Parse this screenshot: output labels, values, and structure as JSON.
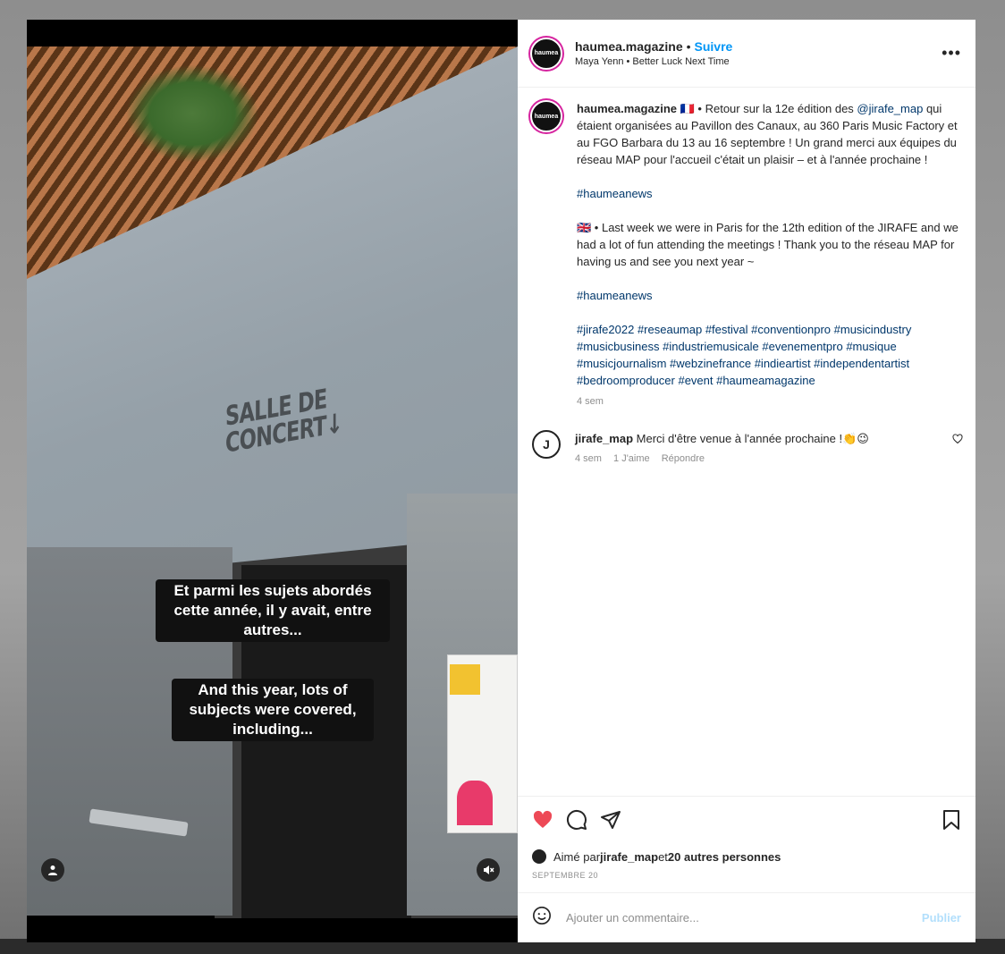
{
  "media": {
    "sign_text": "SALLE DE\nCONCERT↓",
    "caption_fr": "Et parmi les sujets abordés\ncette année, il y avait, entre\nautres...",
    "caption_en": "And this year, lots of\nsubjects were covered,\nincluding..."
  },
  "header": {
    "username": "haumea.magazine",
    "dot": "•",
    "follow": "Suivre",
    "audio": "Maya Yenn • Better Luck Next Time",
    "avatar_text": "haumea"
  },
  "post": {
    "username": "haumea.magazine",
    "flag_fr": "🇫🇷",
    "fr_text_1": " • Retour sur la 12e édition des ",
    "fr_mention": "@jirafe_map",
    "fr_text_2": " qui étaient organisées au Pavillon des Canaux, au 360 Paris Music Factory et au FGO Barbara du 13 au 16 septembre ! Un grand merci aux équipes du réseau MAP pour l'accueil c'était un plaisir – et à l'année prochaine !",
    "hashtag_1": "#haumeanews",
    "flag_en": "🇬🇧",
    "en_text": " • Last week we were in Paris for the 12th edition of the JIRAFE and we had a lot of fun attending the meetings ! Thank you to the réseau MAP for having us and see you next year ~",
    "hashtag_2": "#haumeanews",
    "hashtags": "#jirafe2022 #reseaumap #festival #conventionpro #musicindustry #musicbusiness #industriemusicale #evenementpro #musique #musicjournalism #webzinefrance #indieartist #independentartist #bedroomproducer #event #haumeamagazine",
    "time": "4 sem"
  },
  "reply": {
    "avatar_text": "J",
    "username": "jirafe_map",
    "text": " Merci d'être venue à l'année prochaine !👏😉",
    "time": "4 sem",
    "likes": "1 J'aime",
    "reply_label": "Répondre"
  },
  "actions": {
    "liked_by_prefix": "Aimé par ",
    "liked_by_user": "jirafe_map",
    "liked_by_middle": " et ",
    "liked_by_others": "20 autres personnes",
    "date": "SEPTEMBRE 20"
  },
  "comment_box": {
    "placeholder": "Ajouter un commentaire...",
    "post_label": "Publier"
  },
  "icons": {
    "more": "more-horizontal-icon",
    "like": "heart-filled-icon",
    "comment": "comment-bubble-icon",
    "share": "paper-plane-icon",
    "save": "bookmark-icon",
    "emoji": "smiley-icon",
    "user": "user-tag-icon",
    "mute": "speaker-muted-icon"
  },
  "colors": {
    "like": "#ed4956",
    "link": "#00376b",
    "follow": "#0095f6",
    "post_disabled": "#b2dffc"
  }
}
